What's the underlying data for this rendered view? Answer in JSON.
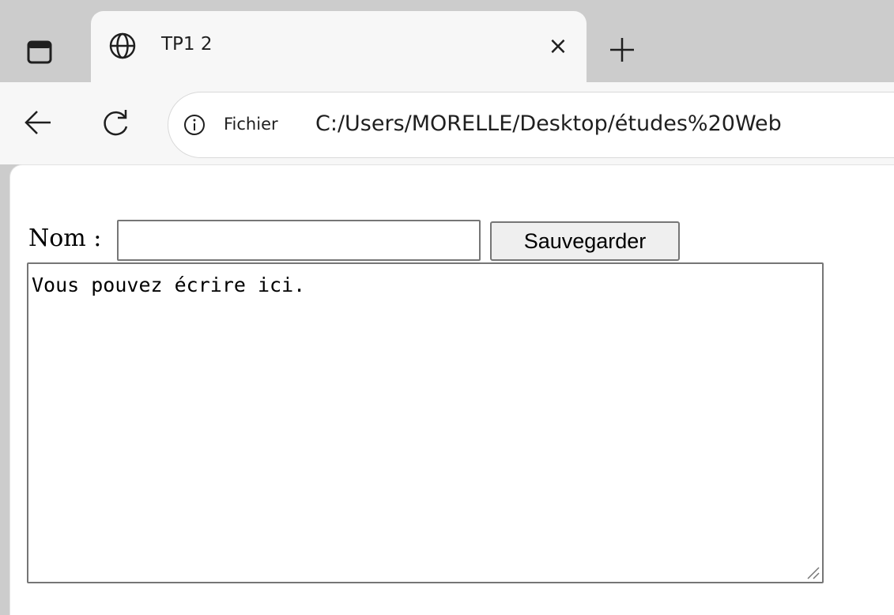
{
  "browser": {
    "tab": {
      "title": "TP1 2",
      "close_glyph": "×"
    },
    "address_bar": {
      "chip": "Fichier",
      "url": "C:/Users/MORELLE/Desktop/études%20Web"
    },
    "icons": [
      "tab-actions-icon",
      "globe-icon",
      "close-icon",
      "plus-icon",
      "back-arrow-icon",
      "reload-icon",
      "info-icon"
    ]
  },
  "page": {
    "form": {
      "nom_label": "Nom :",
      "nom_value": "",
      "save_label": "Sauvegarder",
      "textarea_value": "Vous pouvez écrire ici."
    }
  }
}
